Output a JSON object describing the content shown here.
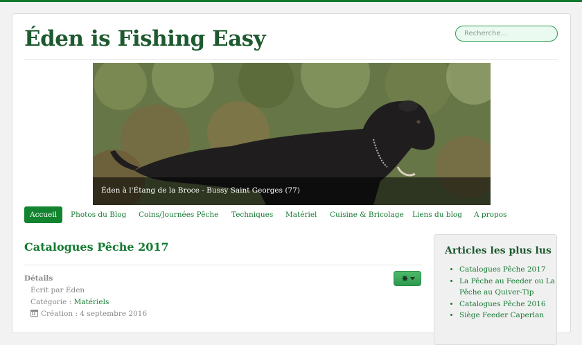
{
  "site": {
    "title": "Éden is Fishing Easy"
  },
  "search": {
    "placeholder": "Recherche..."
  },
  "banner": {
    "caption": "Éden à l'Étang de la Broce - Bussy Saint Georges (77)"
  },
  "nav": {
    "items": [
      {
        "label": "Accueil",
        "active": true
      },
      {
        "label": "Photos du Blog"
      },
      {
        "label": "Coins/Journées Pêche"
      },
      {
        "label": "Techniques"
      },
      {
        "label": "Matériel"
      },
      {
        "label": "Cuisine & Bricolage"
      },
      {
        "label": "Liens du blog"
      },
      {
        "label": "A propos"
      }
    ]
  },
  "article": {
    "title": "Catalogues Pêche 2017",
    "details_label": "Détails",
    "author": "Écrit par Éden",
    "category_prefix": "Catégorie : ",
    "category": "Matériels",
    "created": "Création : 4 septembre 2016"
  },
  "sidebar": {
    "title": "Articles les plus lus",
    "items": [
      "Catalogues Pêche 2017",
      "La Pêche au Feeder ou La Pêche au Quiver-Tip",
      "Catalogues Pêche 2016",
      "Siège Feeder Caperlan"
    ]
  },
  "colors": {
    "accent": "#12832f",
    "title": "#1e5a30",
    "link": "#157a32"
  },
  "icons": {
    "tools": "gear-icon",
    "calendar": "calendar-icon"
  }
}
